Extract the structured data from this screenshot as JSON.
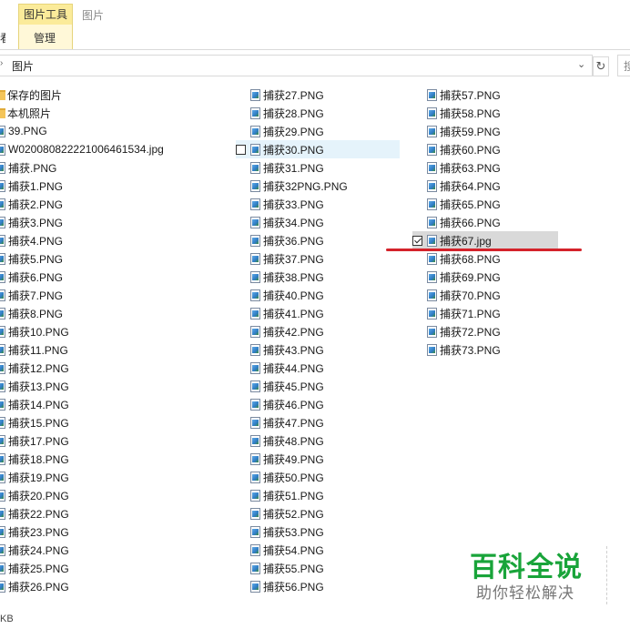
{
  "ribbon": {
    "context_tab": "图片工具",
    "window_title": "图片",
    "manage_label": "管理",
    "left_cut_label": "看"
  },
  "address_bar": {
    "path": "图片",
    "dropdown_glyph": "⌄",
    "refresh_glyph": "↻",
    "search_cut_label": "搜"
  },
  "files": {
    "column_1": [
      {
        "name": "保存的图片",
        "type": "folder"
      },
      {
        "name": "本机照片",
        "type": "folder"
      },
      {
        "name": "39.PNG",
        "type": "image"
      },
      {
        "name": "W020080822221006461534.jpg",
        "type": "image"
      },
      {
        "name": "捕获.PNG",
        "type": "image"
      },
      {
        "name": "捕获1.PNG",
        "type": "image"
      },
      {
        "name": "捕获2.PNG",
        "type": "image"
      },
      {
        "name": "捕获3.PNG",
        "type": "image"
      },
      {
        "name": "捕获4.PNG",
        "type": "image"
      },
      {
        "name": "捕获5.PNG",
        "type": "image"
      },
      {
        "name": "捕获6.PNG",
        "type": "image"
      },
      {
        "name": "捕获7.PNG",
        "type": "image"
      },
      {
        "name": "捕获8.PNG",
        "type": "image"
      },
      {
        "name": "捕获10.PNG",
        "type": "image"
      },
      {
        "name": "捕获11.PNG",
        "type": "image"
      },
      {
        "name": "捕获12.PNG",
        "type": "image"
      },
      {
        "name": "捕获13.PNG",
        "type": "image"
      },
      {
        "name": "捕获14.PNG",
        "type": "image"
      },
      {
        "name": "捕获15.PNG",
        "type": "image"
      },
      {
        "name": "捕获17.PNG",
        "type": "image"
      },
      {
        "name": "捕获18.PNG",
        "type": "image"
      },
      {
        "name": "捕获19.PNG",
        "type": "image"
      },
      {
        "name": "捕获20.PNG",
        "type": "image"
      },
      {
        "name": "捕获22.PNG",
        "type": "image"
      },
      {
        "name": "捕获23.PNG",
        "type": "image"
      },
      {
        "name": "捕获24.PNG",
        "type": "image"
      },
      {
        "name": "捕获25.PNG",
        "type": "image"
      },
      {
        "name": "捕获26.PNG",
        "type": "image"
      }
    ],
    "column_2": [
      {
        "name": "捕获27.PNG",
        "type": "image"
      },
      {
        "name": "捕获28.PNG",
        "type": "image"
      },
      {
        "name": "捕获29.PNG",
        "type": "image"
      },
      {
        "name": "捕获30.PNG",
        "type": "image",
        "hovered": true
      },
      {
        "name": "捕获31.PNG",
        "type": "image"
      },
      {
        "name": "捕获32PNG.PNG",
        "type": "image"
      },
      {
        "name": "捕获33.PNG",
        "type": "image"
      },
      {
        "name": "捕获34.PNG",
        "type": "image"
      },
      {
        "name": "捕获36.PNG",
        "type": "image"
      },
      {
        "name": "捕获37.PNG",
        "type": "image"
      },
      {
        "name": "捕获38.PNG",
        "type": "image"
      },
      {
        "name": "捕获40.PNG",
        "type": "image"
      },
      {
        "name": "捕获41.PNG",
        "type": "image"
      },
      {
        "name": "捕获42.PNG",
        "type": "image"
      },
      {
        "name": "捕获43.PNG",
        "type": "image"
      },
      {
        "name": "捕获44.PNG",
        "type": "image"
      },
      {
        "name": "捕获45.PNG",
        "type": "image"
      },
      {
        "name": "捕获46.PNG",
        "type": "image"
      },
      {
        "name": "捕获47.PNG",
        "type": "image"
      },
      {
        "name": "捕获48.PNG",
        "type": "image"
      },
      {
        "name": "捕获49.PNG",
        "type": "image"
      },
      {
        "name": "捕获50.PNG",
        "type": "image"
      },
      {
        "name": "捕获51.PNG",
        "type": "image"
      },
      {
        "name": "捕获52.PNG",
        "type": "image"
      },
      {
        "name": "捕获53.PNG",
        "type": "image"
      },
      {
        "name": "捕获54.PNG",
        "type": "image"
      },
      {
        "name": "捕获55.PNG",
        "type": "image"
      },
      {
        "name": "捕获56.PNG",
        "type": "image"
      }
    ],
    "column_3": [
      {
        "name": "捕获57.PNG",
        "type": "image"
      },
      {
        "name": "捕获58.PNG",
        "type": "image"
      },
      {
        "name": "捕获59.PNG",
        "type": "image"
      },
      {
        "name": "捕获60.PNG",
        "type": "image"
      },
      {
        "name": "捕获63.PNG",
        "type": "image"
      },
      {
        "name": "捕获64.PNG",
        "type": "image"
      },
      {
        "name": "捕获65.PNG",
        "type": "image"
      },
      {
        "name": "捕获66.PNG",
        "type": "image"
      },
      {
        "name": "捕获67.jpg",
        "type": "image",
        "selected": true
      },
      {
        "name": "捕获68.PNG",
        "type": "image"
      },
      {
        "name": "捕获69.PNG",
        "type": "image"
      },
      {
        "name": "捕获70.PNG",
        "type": "image"
      },
      {
        "name": "捕获71.PNG",
        "type": "image"
      },
      {
        "name": "捕获72.PNG",
        "type": "image"
      },
      {
        "name": "捕获73.PNG",
        "type": "image"
      }
    ]
  },
  "status_bar": {
    "size_text": "KB"
  },
  "watermark": {
    "title": "百科全说",
    "subtitle": "助你轻松解决"
  },
  "colors": {
    "context_tab_bg": "#fbeb9a",
    "selected_row_bg": "#d9d9d9",
    "hover_row_bg": "#e5f3fb",
    "annotation_red": "#d4232b",
    "watermark_green": "#19a43a"
  }
}
